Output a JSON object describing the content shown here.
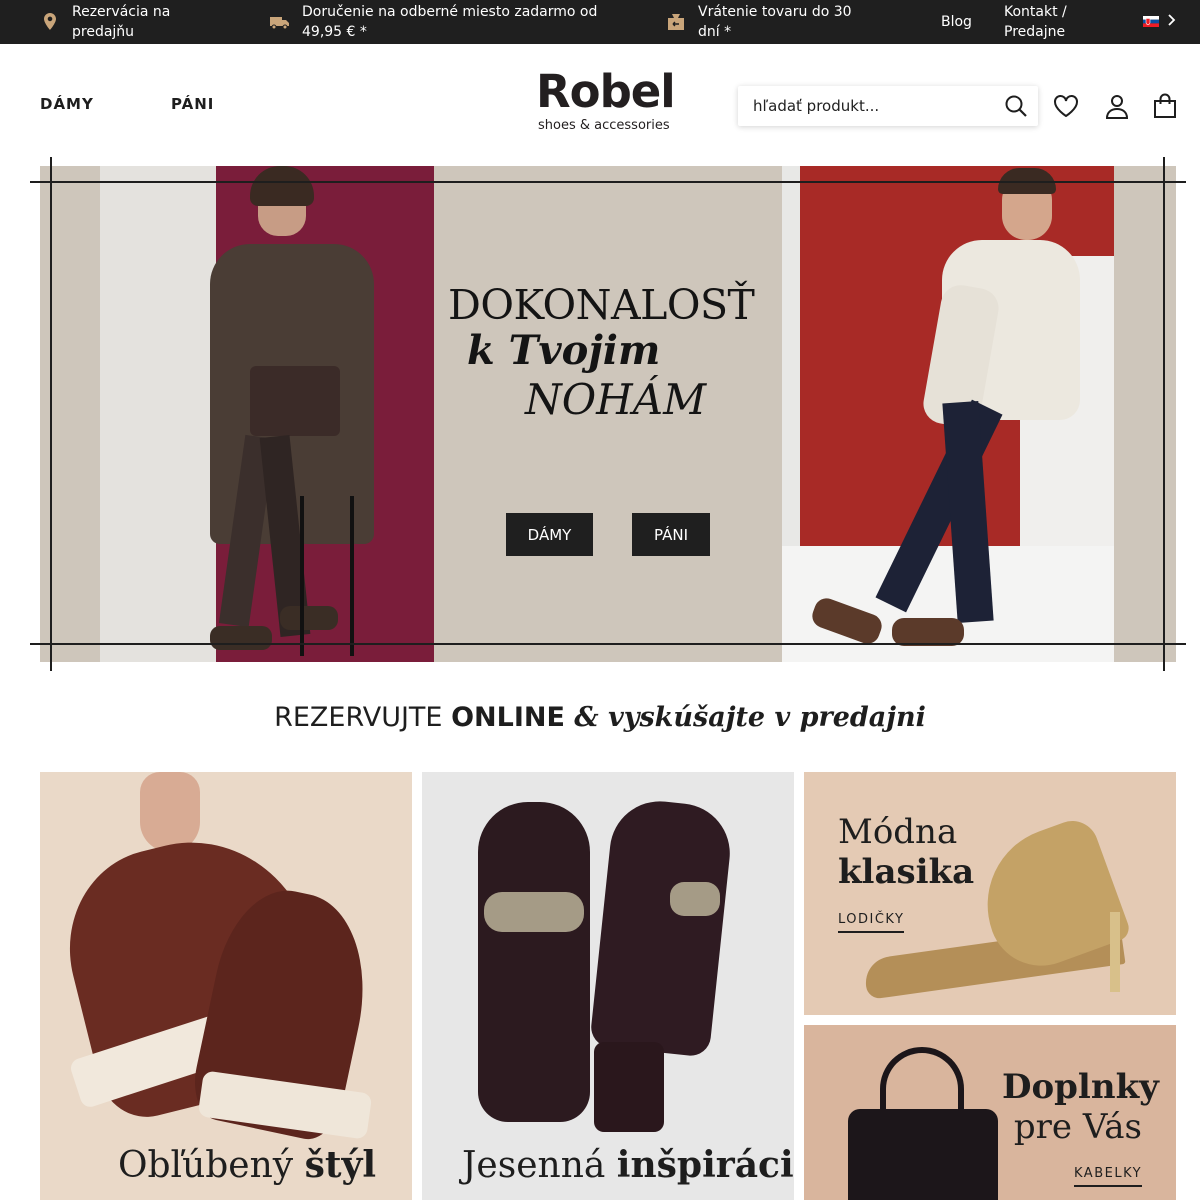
{
  "topbar": {
    "items": [
      {
        "icon": "location-pin-icon",
        "line1": "Rezervácia na",
        "line2": "predajňu"
      },
      {
        "icon": "delivery-truck-icon",
        "line1": "Doručenie na odberné miesto zadarmo od",
        "line2": "49,95 € *"
      },
      {
        "icon": "return-box-icon",
        "line1": "Vrátenie tovaru do 30",
        "line2": "dní *"
      }
    ],
    "blog": "Blog",
    "contact_line1": "Kontakt /",
    "contact_line2": "Predajne",
    "language_flag": "slovak-flag-icon"
  },
  "header": {
    "nav": {
      "women": "DÁMY",
      "men": "PÁNI"
    },
    "logo": {
      "word": "Robel",
      "tagline": "shoes & accessories"
    },
    "search": {
      "placeholder": "hľadať produkt...",
      "value": ""
    }
  },
  "hero": {
    "line1": "DOKONALOSŤ",
    "line2": "k Tvojim",
    "line3": "NOHÁM",
    "btn_women": "DÁMY",
    "btn_men": "PÁNI"
  },
  "tagline": {
    "part1": "REZERVUJTE ",
    "part2": "ONLINE",
    "part3": " & vyskúšajte v predajni"
  },
  "tiles": {
    "favorite": {
      "caption_light": "Obľúbený ",
      "caption_bold": "štýl"
    },
    "autumn": {
      "caption_light": "Jesenná ",
      "caption_bold": "inšpirácia"
    },
    "classic": {
      "title_light": "Módna",
      "title_bold": "klasika",
      "link": "LODIČKY"
    },
    "accessories": {
      "title_bold": "Doplnky",
      "title_light": "pre Vás",
      "link": "KABELKY"
    }
  },
  "colors": {
    "topbar_bg": "#1f1f1f",
    "hero_bg": "#cec6bb",
    "button_bg": "#1f1f1f",
    "text": "#1e1e1e"
  }
}
